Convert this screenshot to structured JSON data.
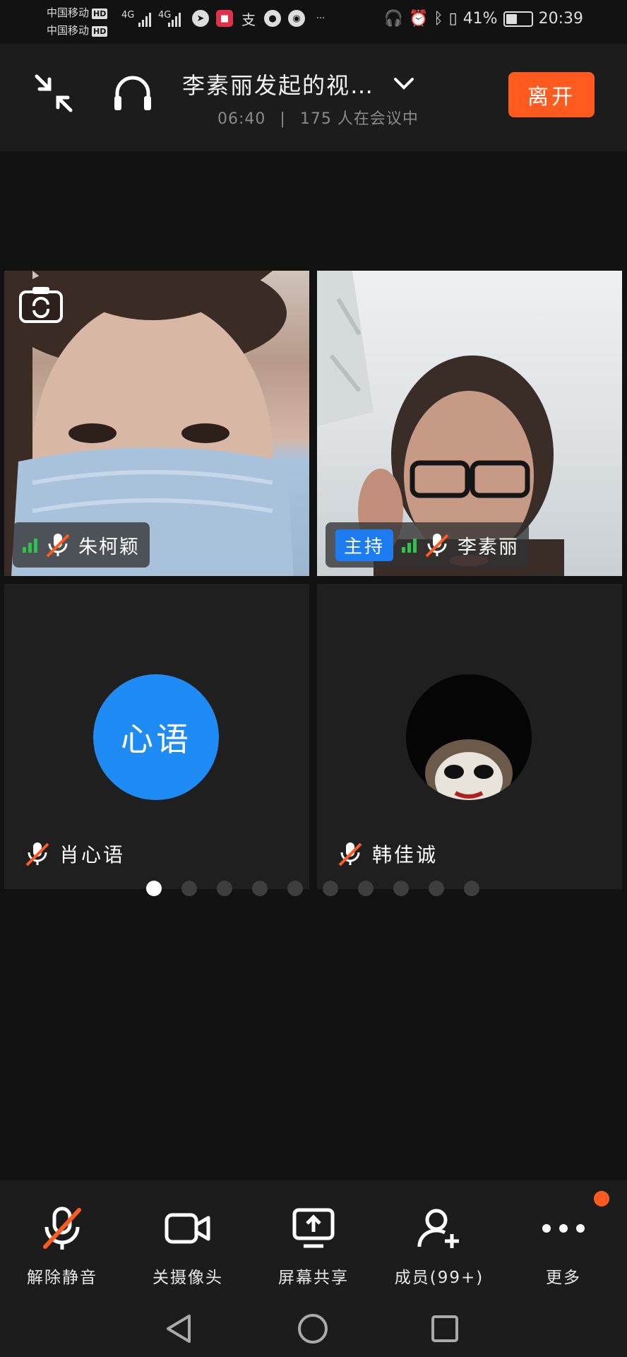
{
  "status_bar": {
    "carrier1": "中国移动",
    "carrier2": "中国移动",
    "hd_badge": "HD",
    "network": "4G",
    "battery_pct": "41%",
    "time": "20:39",
    "app_icons": [
      "arrow-app-icon",
      "video-app-icon",
      "alipay-icon",
      "message-icon",
      "wechat-icon"
    ],
    "more": "···"
  },
  "header": {
    "title": "李素丽发起的视…",
    "duration": "06:40",
    "separator": "|",
    "participants": "175 人在会议中",
    "leave_label": "离开",
    "leave_color": "#ff5b1f"
  },
  "tiles": [
    {
      "name": "朱柯颖",
      "host": false,
      "signal": true,
      "muted": true
    },
    {
      "name": "李素丽",
      "host": true,
      "host_label": "主持",
      "signal": true,
      "muted": true
    },
    {
      "name": "肖心语",
      "avatar_text": "心语",
      "avatar_color": "#1e8cf4",
      "muted": true
    },
    {
      "name": "韩佳诚",
      "avatar": "photo",
      "muted": true
    }
  ],
  "pagination": {
    "pages": 10,
    "current": 1
  },
  "toolbar": {
    "unmute": "解除静音",
    "camera": "关摄像头",
    "share": "屏幕共享",
    "members": "成员(99+)",
    "more": "更多"
  },
  "accent_colors": {
    "blue": "#1e7cf2",
    "orange": "#ff5b1f",
    "signal_green": "#30c24e",
    "mute_red": "#ff5b1f"
  }
}
